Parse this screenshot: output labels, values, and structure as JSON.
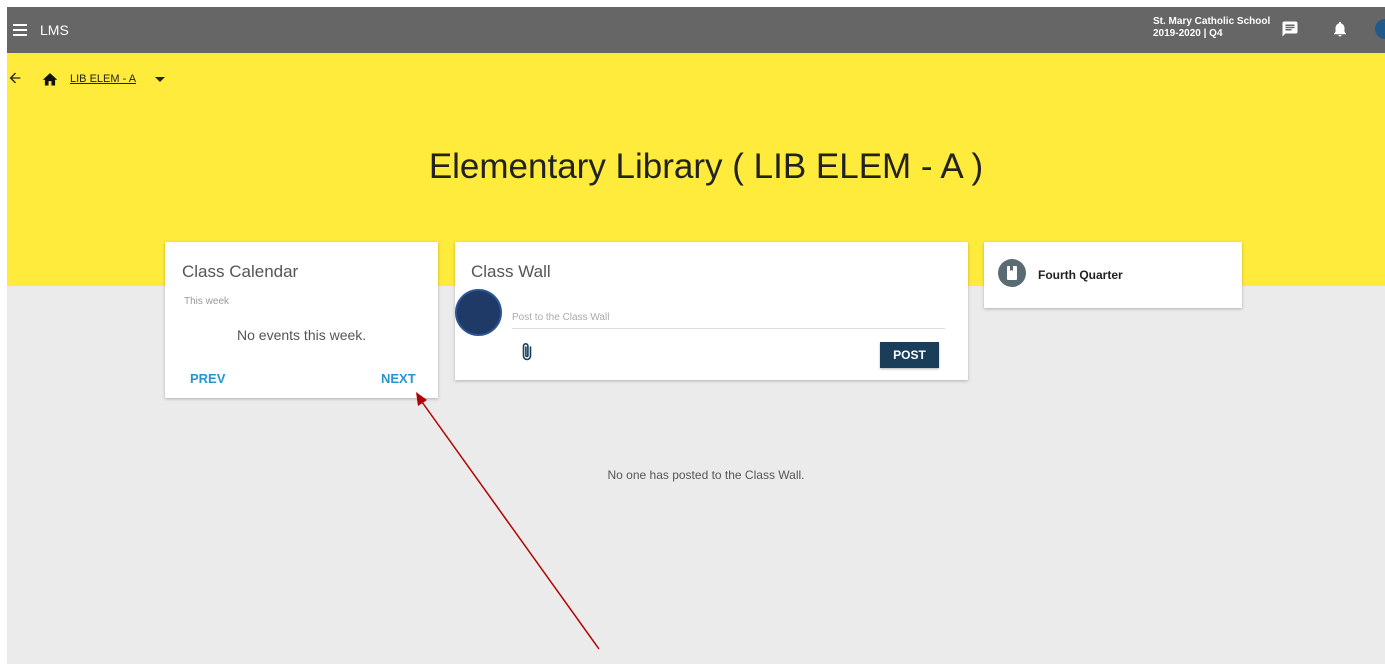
{
  "app": {
    "title": "LMS"
  },
  "header": {
    "school_name": "St. Mary Catholic School",
    "term": "2019-2020 | Q4",
    "icons": [
      "menu-icon",
      "chat-icon",
      "bell-icon"
    ]
  },
  "breadcrumb": {
    "course_code": "LIB ELEM - A"
  },
  "page": {
    "title": "Elementary Library ( LIB ELEM - A )"
  },
  "calendar": {
    "title": "Class Calendar",
    "period": "This week",
    "empty_text": "No events this week.",
    "prev_label": "PREV",
    "next_label": "NEXT"
  },
  "wall": {
    "title": "Class Wall",
    "input_placeholder": "Post to the Class Wall",
    "post_label": "POST",
    "empty_text": "No one has posted to the Class Wall."
  },
  "quarter": {
    "label": "Fourth Quarter"
  },
  "colors": {
    "header": "#666666",
    "hero": "#ffeb3b",
    "background": "#ebebeb",
    "link_accent": "#2596d0",
    "post_button": "#1a3d5a",
    "annotation_arrow": "#b00000"
  }
}
